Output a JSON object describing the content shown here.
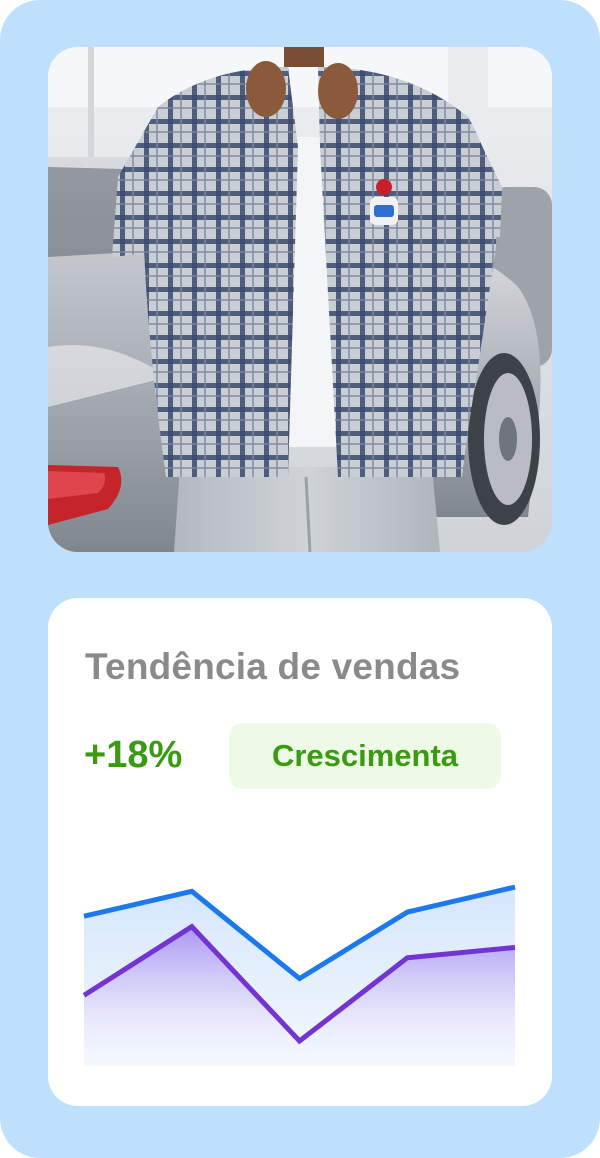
{
  "photo": {
    "alt": "Man in plaid flannel shirt and light jeans standing next to a silver sports car"
  },
  "trend": {
    "title": "Tendência de vendas",
    "change": "+18%",
    "badge": "Crescimenta"
  },
  "colors": {
    "background": "#bfe0fd",
    "card": "#ffffff",
    "title": "#8a8a8d",
    "positive": "#3a9a12",
    "badge_bg": "#edfbe6",
    "series_blue": "#1d78ee",
    "series_purple": "#7434d1"
  },
  "chart_data": {
    "type": "area",
    "x": [
      1,
      2,
      3,
      4,
      5
    ],
    "ylim": [
      0,
      100
    ],
    "grid": false,
    "series": [
      {
        "values": [
          72,
          84,
          42,
          74,
          86
        ],
        "color": "#1d78ee"
      },
      {
        "values": [
          34,
          67,
          12,
          52,
          57
        ],
        "color": "#7434d1"
      }
    ]
  }
}
